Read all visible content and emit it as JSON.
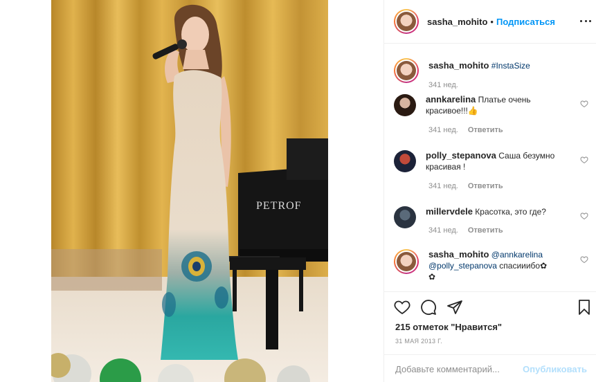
{
  "post_header": {
    "username": "sasha_mohito",
    "separator": "•",
    "follow_label": "Подписаться"
  },
  "photo": {
    "piano_brand": "PETROF"
  },
  "caption": {
    "username": "sasha_mohito",
    "text": "#InstaSize",
    "time": "341 нед."
  },
  "comments": [
    {
      "username": "annkarelina",
      "text_line1": "Платье очень",
      "text_line2": "красивое!!!👍",
      "time": "341 нед.",
      "reply_label": "Ответить"
    },
    {
      "username": "polly_stepanova",
      "text_line1": "Саша безумно",
      "text_line2": "красивая !",
      "time": "341 нед.",
      "reply_label": "Ответить"
    },
    {
      "username": "millervdele",
      "text_line1": "Красотка, это где?",
      "time": "341 нед.",
      "reply_label": "Ответить"
    },
    {
      "username": "sasha_mohito",
      "mention1": "@annkarelina",
      "mention2": "@polly_stepanova",
      "text": "спасииибо✿",
      "text_line2": "✿"
    }
  ],
  "actions": {
    "likes": "215 отметок \"Нравится\"",
    "date": "31 МАЯ 2013 Г.",
    "comment_placeholder": "Добавьте комментарий...",
    "post_label": "Опубликовать"
  },
  "colors": {
    "accent": "#0095f6",
    "post_disabled": "#b2dffc",
    "muted": "#8e8e8e"
  }
}
